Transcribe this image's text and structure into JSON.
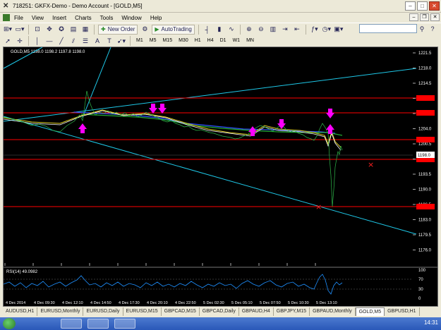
{
  "window": {
    "title": "718251: GKFX-Demo - Demo Account - [GOLD,M5]"
  },
  "menu": [
    "File",
    "View",
    "Insert",
    "Charts",
    "Tools",
    "Window",
    "Help"
  ],
  "toolbar": {
    "new_order": "New Order",
    "autotrading": "AutoTrading"
  },
  "drawing_tools": [
    "A",
    "T"
  ],
  "timeframes": [
    "M1",
    "M5",
    "M15",
    "M30",
    "H1",
    "H4",
    "D1",
    "W1",
    "MN"
  ],
  "chart": {
    "header": "GOLD,M5  1198.0 1198.2 1197.8 1198.0",
    "price_labels": [
      "1221.5",
      "1218.0",
      "1214.5",
      "1211.0",
      "1207.5",
      "1204.0",
      "1200.5",
      "1197.0",
      "1193.5",
      "1190.0",
      "1186.5",
      "1183.0",
      "1179.5",
      "1176.0"
    ],
    "current_price_tag": "1198.0",
    "time_labels": [
      "4 Dec 2014",
      "4 Dec 09:30",
      "4 Dec 12:10",
      "4 Dec 14:50",
      "4 Dec 17:30",
      "4 Dec 20:10",
      "4 Dec 22:50",
      "5 Dec 02:30",
      "5 Dec 05:10",
      "5 Dec 07:50",
      "5 Dec 10:30",
      "5 Dec 13:10"
    ],
    "colors": {
      "bg": "#000000",
      "hline": "#ff0000",
      "trend": "#1ec8e8",
      "arrow": "#ff00ff",
      "rsi": "#1e90ff"
    }
  },
  "rsi": {
    "header": "RSI(14) 49.0982",
    "levels": [
      "100",
      "70",
      "30",
      "0"
    ]
  },
  "tabs": [
    "AUDUSD,H1",
    "EURUSD,Monthly",
    "EURUSD,Daily",
    "EURUSD,M15",
    "GBPCAD,M15",
    "GBPCAD,Daily",
    "GBPAUD,H4",
    "GBPJPY,M15",
    "GBPAUD,Monthly",
    "GOLD,M5",
    "GBPUSD,H1"
  ],
  "active_tab": "GOLD,M5",
  "taskbar": {
    "clock": "14:31"
  }
}
